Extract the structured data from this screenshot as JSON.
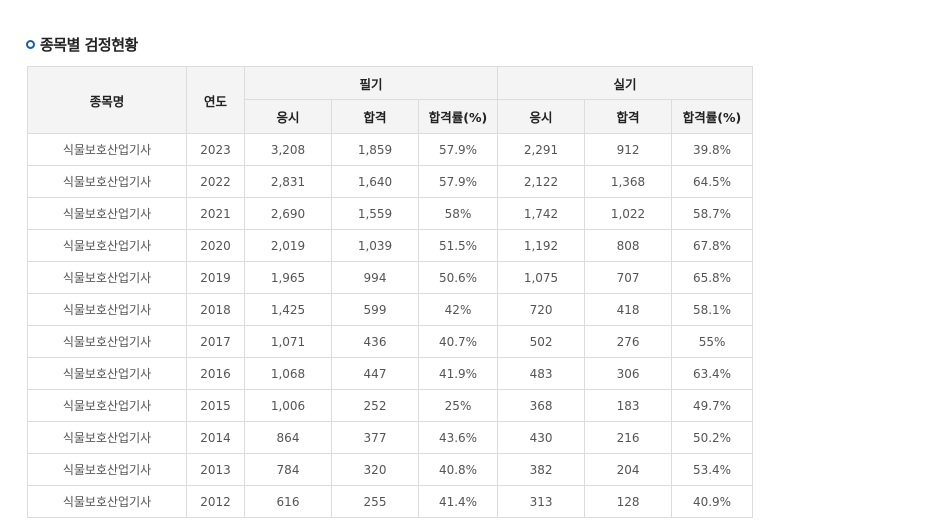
{
  "section": {
    "title": "종목별 검정현황"
  },
  "table": {
    "headers": {
      "item": "종목명",
      "year": "연도",
      "written": "필기",
      "practical": "실기",
      "applicants": "응시",
      "passed": "합격",
      "rate": "합격률(%)"
    },
    "rows": [
      {
        "name": "식물보호산업기사",
        "year": "2023",
        "w_app": "3,208",
        "w_pass": "1,859",
        "w_rate": "57.9%",
        "p_app": "2,291",
        "p_pass": "912",
        "p_rate": "39.8%"
      },
      {
        "name": "식물보호산업기사",
        "year": "2022",
        "w_app": "2,831",
        "w_pass": "1,640",
        "w_rate": "57.9%",
        "p_app": "2,122",
        "p_pass": "1,368",
        "p_rate": "64.5%"
      },
      {
        "name": "식물보호산업기사",
        "year": "2021",
        "w_app": "2,690",
        "w_pass": "1,559",
        "w_rate": "58%",
        "p_app": "1,742",
        "p_pass": "1,022",
        "p_rate": "58.7%"
      },
      {
        "name": "식물보호산업기사",
        "year": "2020",
        "w_app": "2,019",
        "w_pass": "1,039",
        "w_rate": "51.5%",
        "p_app": "1,192",
        "p_pass": "808",
        "p_rate": "67.8%"
      },
      {
        "name": "식물보호산업기사",
        "year": "2019",
        "w_app": "1,965",
        "w_pass": "994",
        "w_rate": "50.6%",
        "p_app": "1,075",
        "p_pass": "707",
        "p_rate": "65.8%"
      },
      {
        "name": "식물보호산업기사",
        "year": "2018",
        "w_app": "1,425",
        "w_pass": "599",
        "w_rate": "42%",
        "p_app": "720",
        "p_pass": "418",
        "p_rate": "58.1%"
      },
      {
        "name": "식물보호산업기사",
        "year": "2017",
        "w_app": "1,071",
        "w_pass": "436",
        "w_rate": "40.7%",
        "p_app": "502",
        "p_pass": "276",
        "p_rate": "55%"
      },
      {
        "name": "식물보호산업기사",
        "year": "2016",
        "w_app": "1,068",
        "w_pass": "447",
        "w_rate": "41.9%",
        "p_app": "483",
        "p_pass": "306",
        "p_rate": "63.4%"
      },
      {
        "name": "식물보호산업기사",
        "year": "2015",
        "w_app": "1,006",
        "w_pass": "252",
        "w_rate": "25%",
        "p_app": "368",
        "p_pass": "183",
        "p_rate": "49.7%"
      },
      {
        "name": "식물보호산업기사",
        "year": "2014",
        "w_app": "864",
        "w_pass": "377",
        "w_rate": "43.6%",
        "p_app": "430",
        "p_pass": "216",
        "p_rate": "50.2%"
      },
      {
        "name": "식물보호산업기사",
        "year": "2013",
        "w_app": "784",
        "w_pass": "320",
        "w_rate": "40.8%",
        "p_app": "382",
        "p_pass": "204",
        "p_rate": "53.4%"
      },
      {
        "name": "식물보호산업기사",
        "year": "2012",
        "w_app": "616",
        "w_pass": "255",
        "w_rate": "41.4%",
        "p_app": "313",
        "p_pass": "128",
        "p_rate": "40.9%"
      }
    ]
  }
}
